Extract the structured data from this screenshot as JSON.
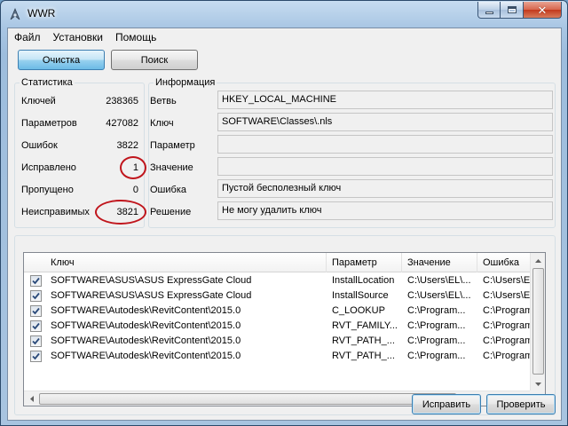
{
  "window": {
    "title": "WWR"
  },
  "menu": {
    "file": "Файл",
    "settings": "Установки",
    "help": "Помощь"
  },
  "toolbar": {
    "clean_label": "Очистка",
    "search_label": "Поиск"
  },
  "statistics": {
    "title": "Статистика",
    "rows": [
      {
        "label": "Ключей",
        "value": "238365"
      },
      {
        "label": "Параметров",
        "value": "427082"
      },
      {
        "label": "Ошибок",
        "value": "3822"
      },
      {
        "label": "Исправлено",
        "value": "1"
      },
      {
        "label": "Пропущено",
        "value": "0"
      },
      {
        "label": "Неисправимых",
        "value": "3821"
      }
    ]
  },
  "info": {
    "title": "Информация",
    "rows": [
      {
        "label": "Ветвь",
        "value": "HKEY_LOCAL_MACHINE"
      },
      {
        "label": "Ключ",
        "value": "SOFTWARE\\Classes\\.nls"
      },
      {
        "label": "Параметр",
        "value": ""
      },
      {
        "label": "Значение",
        "value": ""
      },
      {
        "label": "Ошибка",
        "value": "Пустой бесполезный ключ"
      },
      {
        "label": "Решение",
        "value": "Не могу удалить ключ"
      }
    ]
  },
  "table": {
    "columns": [
      "Ключ",
      "Параметр",
      "Значение",
      "Ошибка"
    ],
    "rows": [
      {
        "key": "SOFTWARE\\ASUS\\ASUS ExpressGate Cloud",
        "param": "InstallLocation",
        "value": "C:\\Users\\EL\\...",
        "error": "C:\\Users\\EL"
      },
      {
        "key": "SOFTWARE\\ASUS\\ASUS ExpressGate Cloud",
        "param": "InstallSource",
        "value": "C:\\Users\\EL\\...",
        "error": "C:\\Users\\EL"
      },
      {
        "key": "SOFTWARE\\Autodesk\\RevitContent\\2015.0",
        "param": "C_LOOKUP",
        "value": "C:\\Program...",
        "error": "C:\\Program..."
      },
      {
        "key": "SOFTWARE\\Autodesk\\RevitContent\\2015.0",
        "param": "RVT_FAMILY...",
        "value": "C:\\Program...",
        "error": "C:\\Program..."
      },
      {
        "key": "SOFTWARE\\Autodesk\\RevitContent\\2015.0",
        "param": "RVT_PATH_...",
        "value": "C:\\Program...",
        "error": "C:\\Program..."
      },
      {
        "key": "SOFTWARE\\Autodesk\\RevitContent\\2015.0",
        "param": "RVT_PATH_...",
        "value": "C:\\Program...",
        "error": "C:\\Program..."
      }
    ]
  },
  "footer": {
    "fix_label": "Исправить",
    "check_label": "Проверить"
  }
}
